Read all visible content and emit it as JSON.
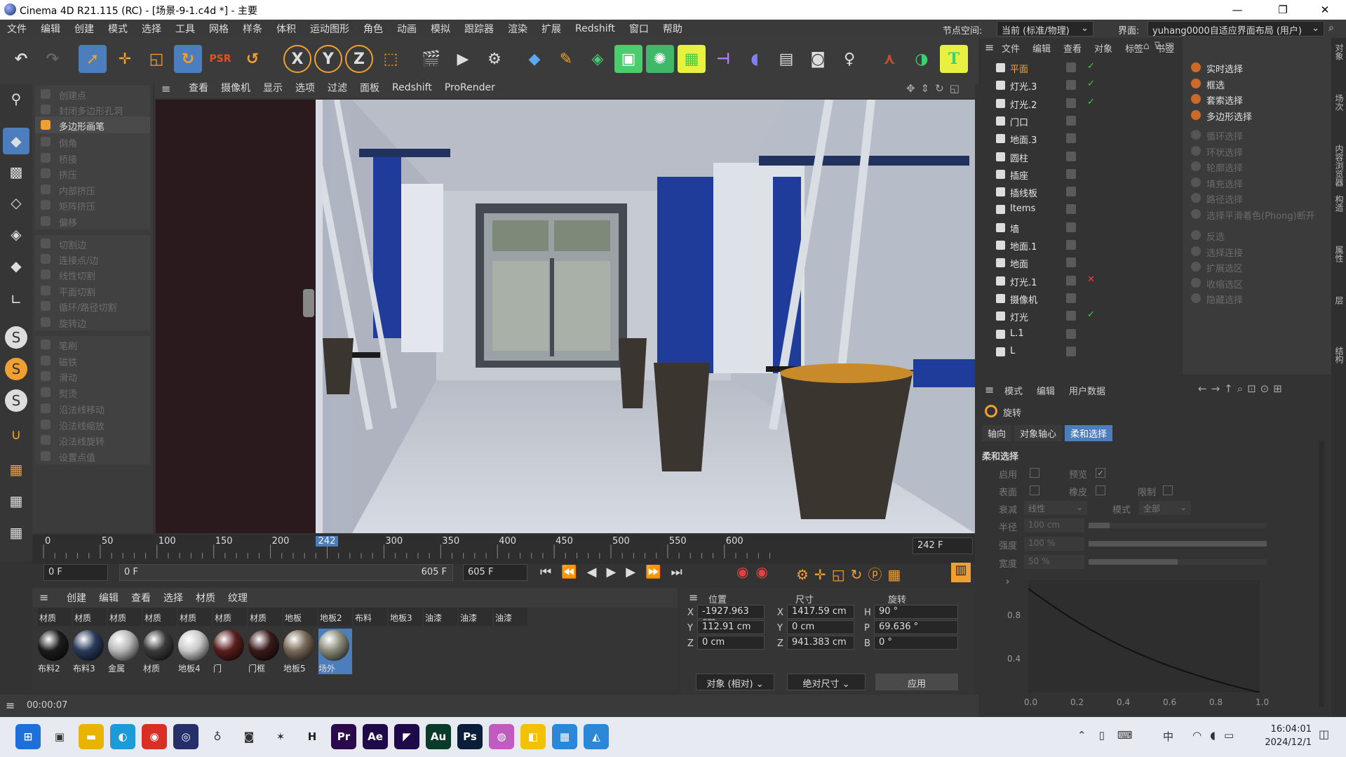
{
  "titlebar": {
    "title": "Cinema 4D R21.115 (RC) - [场景-9-1.c4d *] - 主要",
    "minimize": "—",
    "maximize": "❐",
    "close": "✕"
  },
  "menubar": {
    "items": [
      "文件",
      "编辑",
      "创建",
      "模式",
      "选择",
      "工具",
      "网格",
      "样条",
      "体积",
      "运动图形",
      "角色",
      "动画",
      "模拟",
      "跟踪器",
      "渲染",
      "扩展",
      "Redshift",
      "窗口",
      "帮助"
    ],
    "node_space_label": "节点空间:",
    "node_space_value": "当前 (标准/物理)",
    "layout_label": "界面:",
    "layout_value": "yuhang0000自适应界面布局 (用户)"
  },
  "left_panel": {
    "items": [
      "创建点",
      "封闭多边形孔洞",
      "多边形画笔",
      "倒角",
      "桥接",
      "挤压",
      "内部挤压",
      "矩阵挤压",
      "偏移",
      "切割边",
      "连接点/边",
      "线性切割",
      "平面切割",
      "循环/路径切割",
      "旋转边",
      "笔刷",
      "磁铁",
      "滑动",
      "熨烫",
      "沿法线移动",
      "沿法线缩放",
      "沿法线旋转",
      "设置点值"
    ],
    "active": "多边形画笔"
  },
  "viewport_menu": [
    "查看",
    "摄像机",
    "显示",
    "选项",
    "过滤",
    "面板",
    "Redshift",
    "ProRender"
  ],
  "timeline": {
    "ticks": [
      "0",
      "50",
      "100",
      "150",
      "200",
      "242",
      "300",
      "350",
      "400",
      "450",
      "500",
      "550",
      "600"
    ],
    "current_frame": "242",
    "frame_field": "242 F"
  },
  "transport": {
    "start": "0 F",
    "range_start": "0 F",
    "range_end": "605 F",
    "end": "605 F"
  },
  "material_menu": [
    "创建",
    "编辑",
    "查看",
    "选择",
    "材质",
    "纹理"
  ],
  "materials_row1": [
    "材质",
    "材质",
    "材质",
    "材质",
    "材质",
    "材质",
    "材质",
    "地板",
    "地板2",
    "布料",
    "地板3",
    "油漆",
    "油漆",
    "油漆"
  ],
  "materials_row2": [
    {
      "name": "布料2",
      "color": "#1c1c1c"
    },
    {
      "name": "布料3",
      "color": "#2a3a5a"
    },
    {
      "name": "金属",
      "color": "#b8b8b8"
    },
    {
      "name": "材质",
      "color": "#3a3a3a"
    },
    {
      "name": "地板4",
      "color": "#c9c9c9"
    },
    {
      "name": "门",
      "color": "#5a1e1e"
    },
    {
      "name": "门框",
      "color": "#3a1a1a"
    },
    {
      "name": "地板5",
      "color": "#7a6a5a"
    },
    {
      "name": "场外",
      "color": "#8a8a7a"
    }
  ],
  "coords": {
    "headers": [
      "位置",
      "尺寸",
      "旋转"
    ],
    "rows": [
      {
        "axis": "X",
        "pos": "-1927.963 cm",
        "saxis": "X",
        "size": "1417.59 cm",
        "raxis": "H",
        "rot": "90 °"
      },
      {
        "axis": "Y",
        "pos": "112.91 cm",
        "saxis": "Y",
        "size": "0 cm",
        "raxis": "P",
        "rot": "69.636 °"
      },
      {
        "axis": "Z",
        "pos": "0 cm",
        "saxis": "Z",
        "size": "941.383 cm",
        "raxis": "B",
        "rot": "0 °"
      }
    ],
    "mode": "对象 (相对)",
    "size_mode": "绝对尺寸",
    "apply": "应用"
  },
  "status": {
    "time": "00:00:07"
  },
  "object_manager": {
    "menu": [
      "文件",
      "编辑",
      "查看",
      "对象",
      "标签",
      "书签"
    ],
    "objects": [
      {
        "name": "平面",
        "selected": true,
        "check": "✓",
        "check_color": "#3fcf3f"
      },
      {
        "name": "灯光.3",
        "selected": false,
        "check": "✓",
        "check_color": "#3fcf3f"
      },
      {
        "name": "灯光.2",
        "selected": false,
        "check": "✓",
        "check_color": "#3fcf3f"
      },
      {
        "name": "门口",
        "selected": false,
        "check": "",
        "check_color": "#ddd"
      },
      {
        "name": "地面.3",
        "selected": false,
        "check": "",
        "check_color": "#ddd"
      },
      {
        "name": "圆柱",
        "selected": false,
        "check": "",
        "check_color": "#ddd"
      },
      {
        "name": "插座",
        "selected": false,
        "check": "",
        "check_color": "#ddd"
      },
      {
        "name": "插线板",
        "selected": false,
        "check": "",
        "check_color": "#ddd"
      },
      {
        "name": "Items",
        "selected": false,
        "check": "",
        "check_color": "#ddd"
      },
      {
        "name": "墙",
        "selected": false,
        "check": "",
        "check_color": "#ddd"
      },
      {
        "name": "地面.1",
        "selected": false,
        "check": "",
        "check_color": "#ddd"
      },
      {
        "name": "地面",
        "selected": false,
        "check": "",
        "check_color": "#ddd"
      },
      {
        "name": "灯光.1",
        "selected": false,
        "check": "✕",
        "check_color": "#e84040"
      },
      {
        "name": "摄像机",
        "selected": false,
        "check": "",
        "check_color": "#ddd"
      },
      {
        "name": "灯光",
        "selected": false,
        "check": "✓",
        "check_color": "#3fcf3f"
      },
      {
        "name": "L.1",
        "selected": false,
        "check": "",
        "check_color": "#ddd"
      },
      {
        "name": "L",
        "selected": false,
        "check": "",
        "check_color": "#ddd"
      }
    ]
  },
  "selection_panel": {
    "items": [
      {
        "label": "实时选择",
        "dim": false
      },
      {
        "label": "框选",
        "dim": false
      },
      {
        "label": "套索选择",
        "dim": false
      },
      {
        "label": "多边形选择",
        "dim": false
      },
      {
        "label": "循环选择",
        "dim": true
      },
      {
        "label": "环状选择",
        "dim": true
      },
      {
        "label": "轮廓选择",
        "dim": true
      },
      {
        "label": "填充选择",
        "dim": true
      },
      {
        "label": "路径选择",
        "dim": true
      },
      {
        "label": "选择平滑着色(Phong)断开",
        "dim": true
      },
      {
        "label": "反选",
        "dim": true
      },
      {
        "label": "选择连接",
        "dim": true
      },
      {
        "label": "扩展选区",
        "dim": true
      },
      {
        "label": "收缩选区",
        "dim": true
      },
      {
        "label": "隐藏选择",
        "dim": true
      }
    ]
  },
  "attributes": {
    "menu": [
      "模式",
      "编辑",
      "用户数据"
    ],
    "tool_name": "旋转",
    "tabs": [
      "轴向",
      "对象轴心",
      "柔和选择"
    ],
    "active_tab": "柔和选择",
    "section": "柔和选择",
    "enable": "启用",
    "preview": "预览",
    "surface": "表面",
    "rubber": "橡皮",
    "limit": "限制",
    "falloff_label": "衰减",
    "falloff_value": "线性",
    "mode_label": "模式",
    "mode_value": "全部",
    "radius_label": "半径",
    "radius_value": "100 cm",
    "strength_label": "强度",
    "strength_value": "100 %",
    "width_label": "宽度",
    "width_value": "50 %",
    "curve_y": [
      "0.8",
      "0.4"
    ],
    "curve_x": [
      "0.0",
      "0.2",
      "0.4",
      "0.6",
      "0.8",
      "1.0"
    ]
  },
  "right_strip_tabs": [
    "对象",
    "场次",
    "内容浏览器",
    "构造",
    "属性",
    "层",
    "结构"
  ],
  "taskbar": {
    "time": "16:04:01",
    "date": "2024/12/1",
    "ime": "中",
    "apps": [
      {
        "name": "windows-start",
        "glyph": "⊞",
        "color": "#1e6fd9"
      },
      {
        "name": "task-view",
        "glyph": "▣",
        "color": "#333"
      },
      {
        "name": "file-explorer",
        "glyph": "▬",
        "color": "#e8b400"
      },
      {
        "name": "edge",
        "glyph": "◐",
        "color": "#1d9bd8"
      },
      {
        "name": "chrome",
        "glyph": "◉",
        "color": "#d93025"
      },
      {
        "name": "cinema4d",
        "glyph": "◎",
        "color": "#25306b"
      },
      {
        "name": "alien-app",
        "glyph": "♁",
        "color": "#333"
      },
      {
        "name": "twitch-app",
        "glyph": "◙",
        "color": "#333"
      },
      {
        "name": "runner-app",
        "glyph": "✶",
        "color": "#333"
      },
      {
        "name": "h-app",
        "glyph": "H",
        "color": "#222"
      },
      {
        "name": "premiere",
        "glyph": "Pr",
        "color": "#2a0a4a"
      },
      {
        "name": "after-effects",
        "glyph": "Ae",
        "color": "#1e0a4a"
      },
      {
        "name": "media-encoder",
        "glyph": "◤",
        "color": "#1e0a4a"
      },
      {
        "name": "audition",
        "glyph": "Au",
        "color": "#0a3a2a"
      },
      {
        "name": "photoshop",
        "glyph": "Ps",
        "color": "#0a1e3a"
      },
      {
        "name": "color-app",
        "glyph": "◍",
        "color": "#c05cc0"
      },
      {
        "name": "notes-app",
        "glyph": "◧",
        "color": "#f2c200"
      },
      {
        "name": "window-app",
        "glyph": "▦",
        "color": "#2b88d8"
      },
      {
        "name": "monitor-app",
        "glyph": "◭",
        "color": "#2b88d8"
      }
    ]
  }
}
